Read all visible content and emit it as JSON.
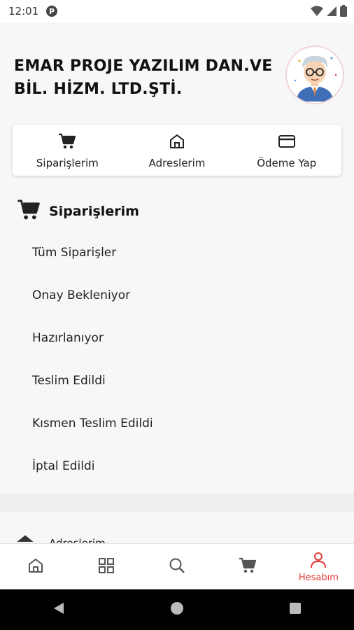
{
  "status_bar": {
    "time": "12:01",
    "icons": [
      "p-app-icon",
      "wifi-icon",
      "signal-icon",
      "battery-icon"
    ]
  },
  "header": {
    "company_name": "EMAR PROJE YAZILIM DAN.VE BİL. HİZM. LTD.ŞTİ.",
    "avatar_icon": "user-avatar-icon"
  },
  "quick_actions": [
    {
      "label": "Siparişlerim",
      "icon": "cart-icon"
    },
    {
      "label": "Adreslerim",
      "icon": "home-icon"
    },
    {
      "label": "Ödeme Yap",
      "icon": "credit-card-icon"
    }
  ],
  "orders": {
    "title": "Siparişlerim",
    "icon": "cart-icon",
    "items": [
      {
        "label": "Tüm Siparişler"
      },
      {
        "label": "Onay Bekleniyor"
      },
      {
        "label": "Hazırlanıyor"
      },
      {
        "label": "Teslim Edildi"
      },
      {
        "label": "Kısmen Teslim Edildi"
      },
      {
        "label": "İptal Edildi"
      }
    ]
  },
  "addresses_peek": {
    "label": "Adreslerim",
    "icon": "home-icon"
  },
  "bottom_nav": {
    "items": [
      {
        "icon": "home-icon",
        "label": ""
      },
      {
        "icon": "grid-icon",
        "label": ""
      },
      {
        "icon": "search-icon",
        "label": ""
      },
      {
        "icon": "cart-icon",
        "label": ""
      },
      {
        "icon": "person-icon",
        "label": "Hesabım",
        "active": true
      }
    ],
    "active_color": "#e53935"
  },
  "system_nav": {
    "icons": [
      "back-icon",
      "home-circle-icon",
      "recents-icon"
    ]
  }
}
